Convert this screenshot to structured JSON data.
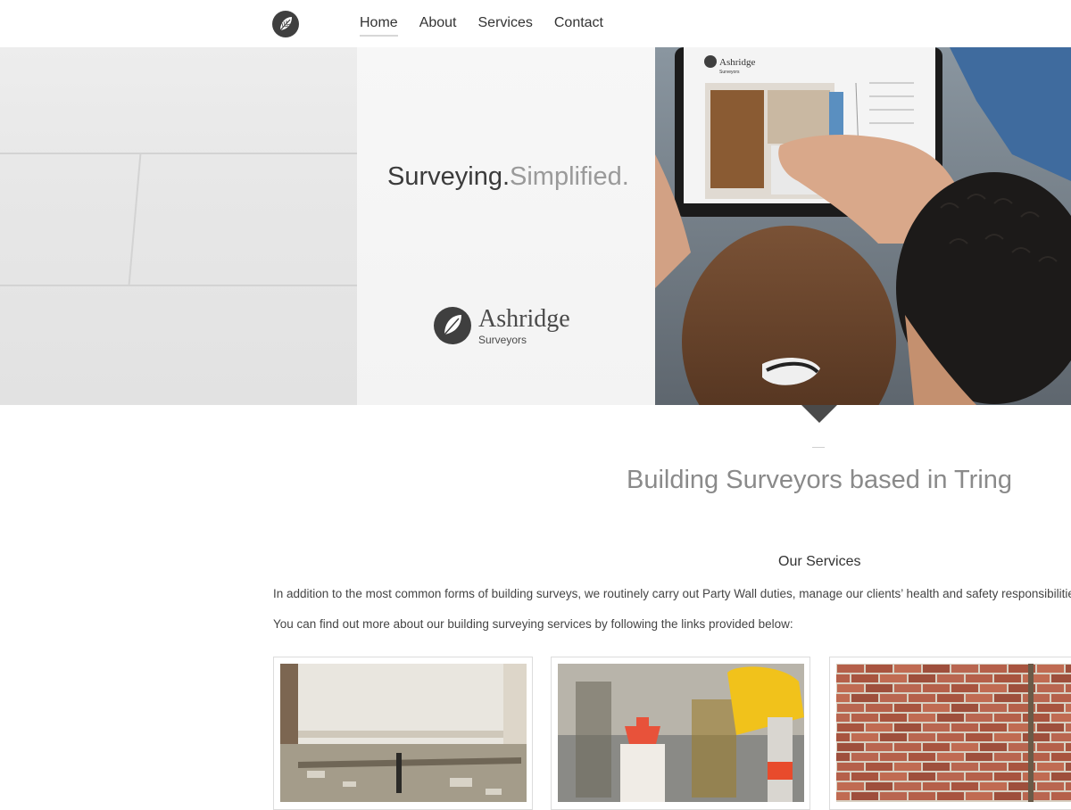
{
  "nav": {
    "items": [
      {
        "label": "Home",
        "active": true
      },
      {
        "label": "About"
      },
      {
        "label": "Services"
      },
      {
        "label": "Contact"
      }
    ]
  },
  "logo_icon": "leaf-icon",
  "hero": {
    "tagline_primary": "Surveying.",
    "tagline_secondary": "Simplified.",
    "brand_name": "Ashridge",
    "brand_sub": "Surveyors",
    "tablet_brand": "Ashridge",
    "tablet_sub": "Surveyors"
  },
  "intro": {
    "title": "Building Surveyors based in Tring"
  },
  "services": {
    "heading": "Our Services",
    "paragraph1": "In addition to the most common forms of building surveys, we routinely carry out Party Wall duties, manage our clients’ health and safety responsibilitie",
    "paragraph2": "You can find out more about our building surveying services by following the links provided below:"
  },
  "colors": {
    "accent_dark": "#4a4a4a",
    "title_grey": "#8a8a8a"
  }
}
